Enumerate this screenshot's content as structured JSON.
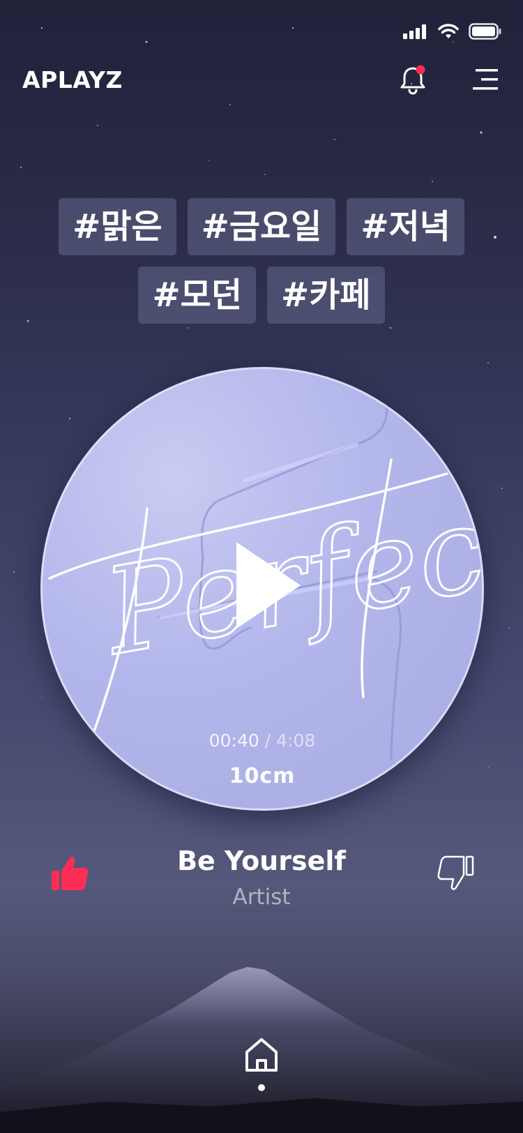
{
  "app": {
    "logo": "APLAYZ",
    "accent_color": "#ff2d55"
  },
  "status_bar": {
    "icons": [
      "signal-icon",
      "wifi-icon",
      "battery-icon"
    ]
  },
  "header": {
    "notification_icon": "bell-icon",
    "notification_has_badge": true,
    "menu_icon": "menu-icon"
  },
  "tags": {
    "row1": [
      "#맑은",
      "#금요일",
      "#저녁"
    ],
    "row2": [
      "#모던",
      "#카페"
    ]
  },
  "player": {
    "album_art_text": "Perfect",
    "current_time": "00:40",
    "separator": "/",
    "total_time": "4:08",
    "album_brand": "10cm",
    "play_icon": "play-icon"
  },
  "song": {
    "title": "Be Yourself",
    "artist": "Artist",
    "like_icon": "thumbs-up-icon",
    "dislike_icon": "thumbs-down-icon"
  },
  "bottom_nav": {
    "home_icon": "home-icon"
  }
}
